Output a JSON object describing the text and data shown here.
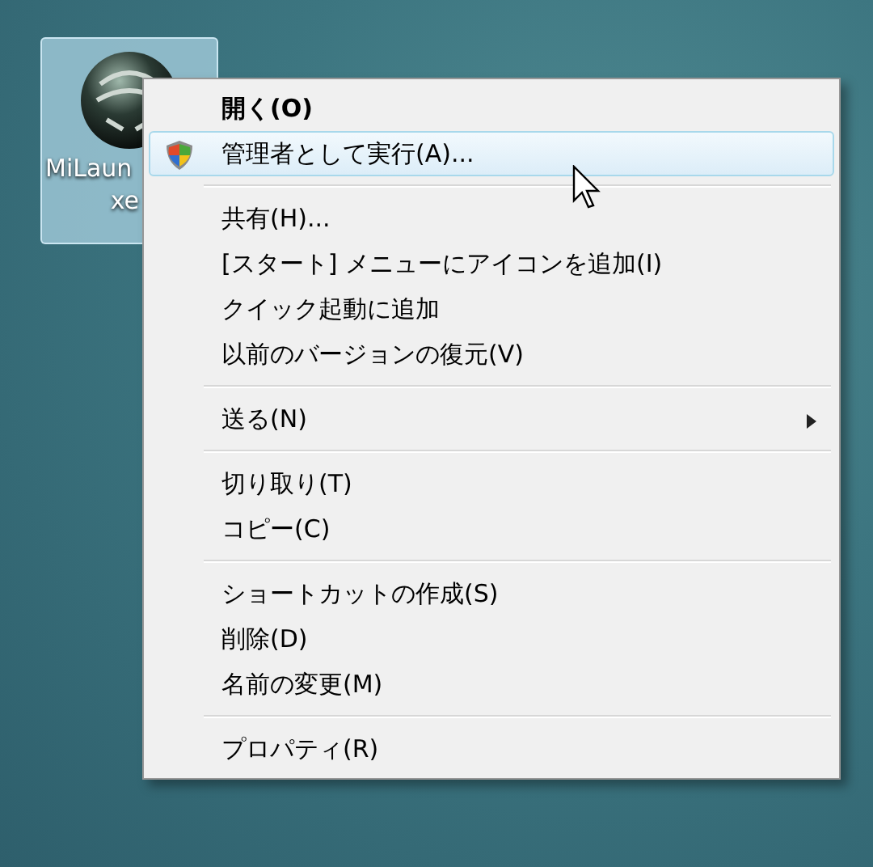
{
  "desktop_icon": {
    "label_lines": [
      "MiLaun",
      "xe"
    ],
    "selected": true
  },
  "context_menu": {
    "groups": [
      [
        {
          "label": "開く(O)",
          "bold": true,
          "shield": false,
          "submenu": false,
          "selected": false
        },
        {
          "label": "管理者として実行(A)...",
          "bold": false,
          "shield": true,
          "submenu": false,
          "selected": true
        }
      ],
      [
        {
          "label": "共有(H)...",
          "bold": false,
          "shield": false,
          "submenu": false,
          "selected": false
        },
        {
          "label": "[スタート] メニューにアイコンを追加(I)",
          "bold": false,
          "shield": false,
          "submenu": false,
          "selected": false
        },
        {
          "label": "クイック起動に追加",
          "bold": false,
          "shield": false,
          "submenu": false,
          "selected": false
        },
        {
          "label": "以前のバージョンの復元(V)",
          "bold": false,
          "shield": false,
          "submenu": false,
          "selected": false
        }
      ],
      [
        {
          "label": "送る(N)",
          "bold": false,
          "shield": false,
          "submenu": true,
          "selected": false
        }
      ],
      [
        {
          "label": "切り取り(T)",
          "bold": false,
          "shield": false,
          "submenu": false,
          "selected": false
        },
        {
          "label": "コピー(C)",
          "bold": false,
          "shield": false,
          "submenu": false,
          "selected": false
        }
      ],
      [
        {
          "label": "ショートカットの作成(S)",
          "bold": false,
          "shield": false,
          "submenu": false,
          "selected": false
        },
        {
          "label": "削除(D)",
          "bold": false,
          "shield": false,
          "submenu": false,
          "selected": false
        },
        {
          "label": "名前の変更(M)",
          "bold": false,
          "shield": false,
          "submenu": false,
          "selected": false
        }
      ],
      [
        {
          "label": "プロパティ(R)",
          "bold": false,
          "shield": false,
          "submenu": false,
          "selected": false
        }
      ]
    ]
  }
}
